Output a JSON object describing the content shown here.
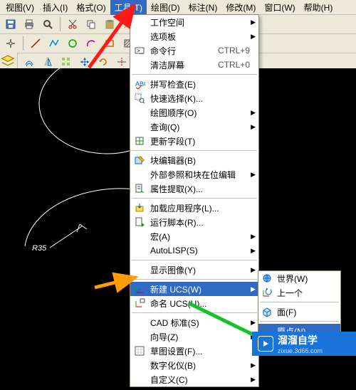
{
  "menubar": {
    "items": [
      "视图(V)",
      "插入(I)",
      "格式(O)",
      "工具(T)",
      "绘图(D)",
      "标注(N)",
      "修改(M)",
      "窗口(W)",
      "帮助(H)"
    ],
    "selected_index": 3
  },
  "tools_menu": {
    "groups": [
      [
        {
          "label": "工作空间",
          "arrow": true
        },
        {
          "label": "选项板",
          "arrow": true
        },
        {
          "label": "命令行",
          "shortcut": "CTRL+9",
          "icon": "cmdline"
        },
        {
          "label": "清洁屏幕",
          "shortcut": "CTRL+0"
        }
      ],
      [
        {
          "label": "拼写检查(E)",
          "icon": "spell"
        },
        {
          "label": "快速选择(K)...",
          "icon": "qsel"
        },
        {
          "label": "绘图顺序(O)",
          "arrow": true
        },
        {
          "label": "查询(Q)",
          "arrow": true
        },
        {
          "label": "更新字段(T)",
          "icon": "field"
        }
      ],
      [
        {
          "label": "块编辑器(B)",
          "icon": "bedit"
        },
        {
          "label": "外部参照和块在位编辑",
          "arrow": true
        },
        {
          "label": "属性提取(X)...",
          "icon": "attr"
        }
      ],
      [
        {
          "label": "加载应用程序(L)...",
          "icon": "load"
        },
        {
          "label": "运行脚本(R)...",
          "icon": "run"
        },
        {
          "label": "宏(A)",
          "arrow": true
        },
        {
          "label": "AutoLISP(S)",
          "arrow": true
        }
      ],
      [
        {
          "label": "显示图像(Y)",
          "arrow": true
        }
      ],
      [
        {
          "label": "新建 UCS(W)",
          "arrow": true,
          "highlight": true,
          "icon": "ucs"
        },
        {
          "label": "命名 UCS(U)...",
          "icon": "nucs"
        }
      ],
      [
        {
          "label": "CAD 标准(S)",
          "arrow": true
        },
        {
          "label": "向导(Z)",
          "arrow": true
        },
        {
          "label": "草图设置(F)...",
          "icon": "draft"
        },
        {
          "label": "数字化仪(B)",
          "arrow": true
        },
        {
          "label": "自定义(C)",
          "arrow": true
        }
      ]
    ]
  },
  "ucs_submenu": {
    "groups": [
      [
        {
          "label": "世界(W)",
          "icon": "world"
        },
        {
          "label": "上一个",
          "icon": "prev"
        }
      ],
      [
        {
          "label": "面(F)",
          "icon": "face"
        }
      ],
      [
        {
          "label": "原点(N)",
          "icon": "origin",
          "highlight": true
        }
      ]
    ]
  },
  "annotation_label": "R35",
  "watermark": {
    "brand": "溜溜自学",
    "url": "zixue.3d66.com"
  }
}
